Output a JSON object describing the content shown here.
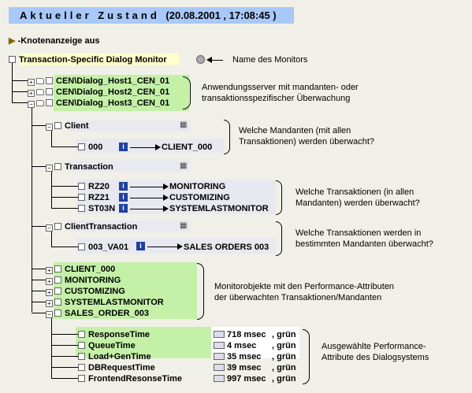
{
  "header": {
    "title": "Aktueller Zustand",
    "timestamp": "(20.08.2001 , 17:08:45 )"
  },
  "toolbar": {
    "node_display": "-Knotenanzeige aus"
  },
  "root": {
    "label": "Transaction-Specific Dialog Monitor",
    "annotation": "Name des Monitors"
  },
  "servers": {
    "items": [
      "CEN\\Dialog_Host1_CEN_01",
      "CEN\\Dialog_Host2_CEN_01",
      "CEN\\Dialog_Host3_CEN_01"
    ],
    "annotation_1": "Anwendungsserver mit mandanten- oder",
    "annotation_2": "transaktionsspezifischer Überwachung"
  },
  "client": {
    "label": "Client",
    "item": "000",
    "target": "CLIENT_000",
    "annotation_1": "Welche Mandanten (mit allen",
    "annotation_2": "Transaktionen) werden überwacht?"
  },
  "transaction": {
    "label": "Transaction",
    "items": [
      {
        "code": "RZ20",
        "target": "MONITORING"
      },
      {
        "code": "RZ21",
        "target": "CUSTOMIZING"
      },
      {
        "code": "ST03N",
        "target": "SYSTEMLASTMONITOR"
      }
    ],
    "annotation_1": "Welche Transaktionen (in allen",
    "annotation_2": "Mandanten) werden überwacht?"
  },
  "client_transaction": {
    "label": "ClientTransaction",
    "item": "003_VA01",
    "target": "SALES ORDERS 003",
    "annotation_1": "Welche Transaktionen werden in",
    "annotation_2": "bestimmten Mandanten überwacht?"
  },
  "monitor_objects": {
    "items": [
      "CLIENT_000",
      "MONITORING",
      "CUSTOMIZING",
      "SYSTEMLASTMONITOR",
      "SALES_ORDER_003"
    ],
    "annotation_1": "Monitorobjekte mit den Performance-Attributen",
    "annotation_2": "der überwachten Transaktionen/Mandanten"
  },
  "attributes": {
    "items": [
      {
        "name": "ResponseTime",
        "value": "718 msec",
        "status": ", grün"
      },
      {
        "name": "QueueTime",
        "value": "4 msec",
        "status": ", grün"
      },
      {
        "name": "Load+GenTime",
        "value": "35 msec",
        "status": ", grün"
      },
      {
        "name": "DBRequestTime",
        "value": "39 msec",
        "status": ", grün"
      },
      {
        "name": "FrontendResonseTime",
        "value": "997 msec",
        "status": ", grün"
      }
    ],
    "annotation_1": "Ausgewählte Performance-",
    "annotation_2": "Attribute des Dialogsystems"
  }
}
